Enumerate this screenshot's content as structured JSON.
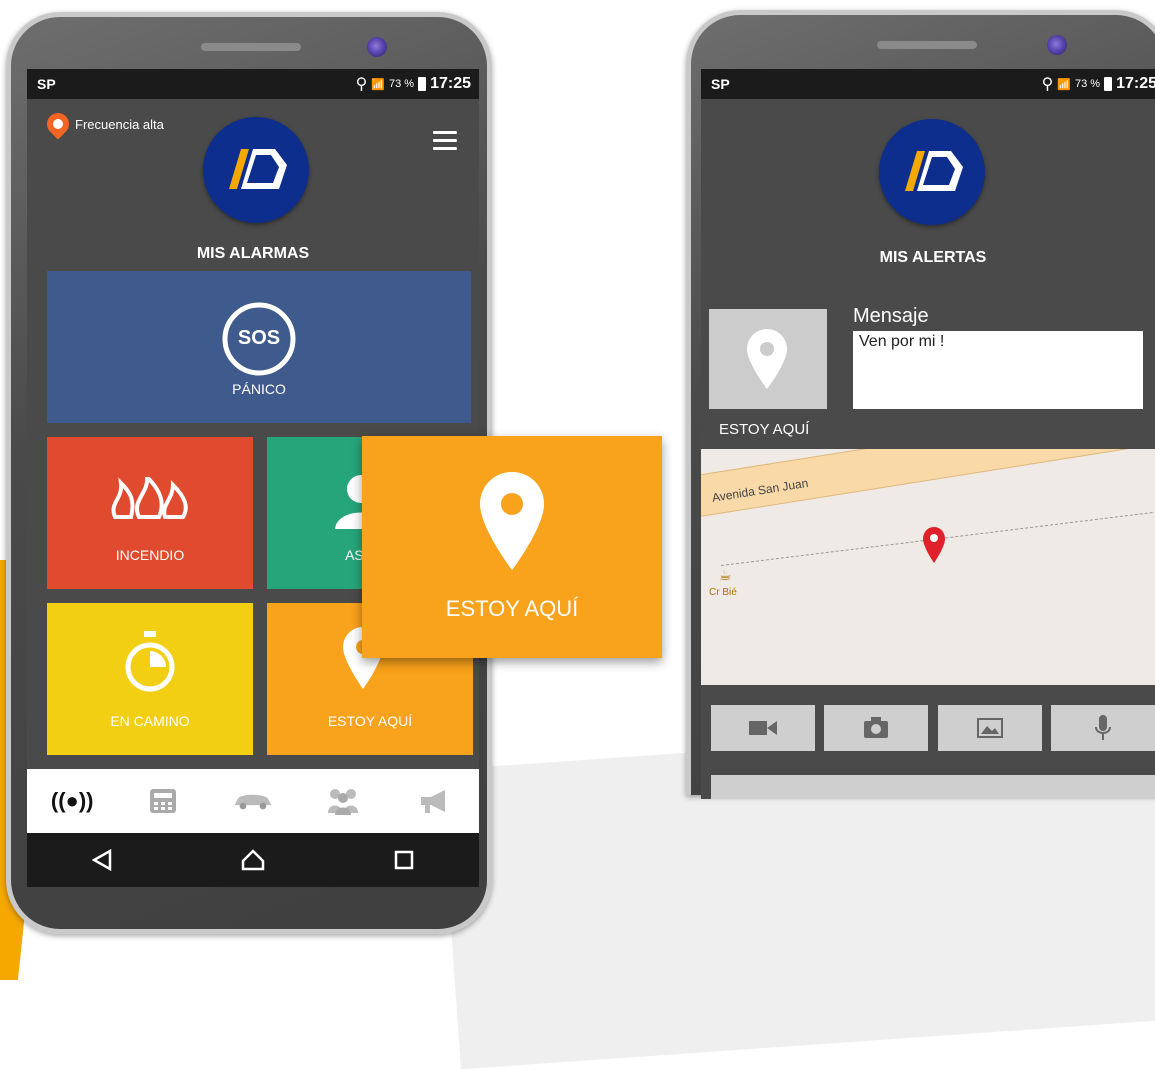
{
  "left_phone": {
    "status": {
      "carrier": "SP",
      "battery": "73 %",
      "time": "17:25"
    },
    "frequency_label": "Frecuencia alta",
    "section_title": "MIS ALARMAS",
    "tiles": {
      "panic": {
        "badge": "SOS",
        "label": "PÁNICO",
        "color": "#3f5a8c"
      },
      "fire": {
        "label": "INCENDIO",
        "color": "#e04a2f"
      },
      "assist": {
        "label": "ASISTE",
        "color": "#27a57a"
      },
      "en_camino": {
        "label": "EN CAMINO",
        "color": "#f3cf14"
      },
      "estoy_aqui": {
        "label": "ESTOY AQUÍ",
        "color": "#f9a21b"
      }
    },
    "popout_label": "ESTOY AQUÍ",
    "bottom_tabs": [
      "broadcast-icon",
      "calculator-icon",
      "car-icon",
      "group-icon",
      "megaphone-icon"
    ],
    "nav_buttons": [
      "back-icon",
      "home-icon",
      "recents-icon"
    ]
  },
  "right_phone": {
    "status": {
      "carrier": "SP",
      "battery": "73 %",
      "time": "17:25"
    },
    "section_title": "MIS ALERTAS",
    "thumb_label": "ESTOY AQUÍ",
    "message": {
      "label": "Mensaje",
      "value": "Ven por mi !"
    },
    "map": {
      "street": "Avenida San Juan",
      "place": "Cr Bié"
    },
    "media_buttons": [
      "video-icon",
      "camera-icon",
      "gallery-icon",
      "microphone-icon"
    ]
  }
}
